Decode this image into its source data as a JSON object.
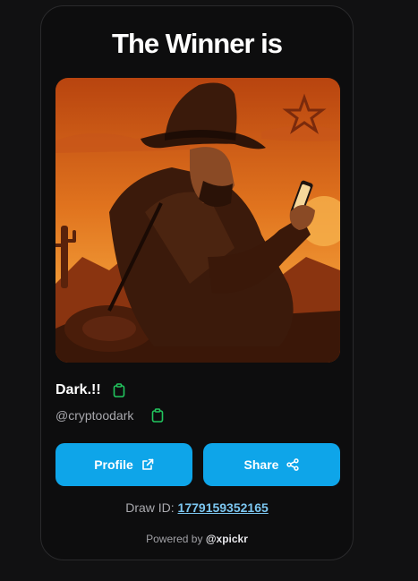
{
  "card": {
    "title": "The Winner is"
  },
  "winner": {
    "avatar_alt": "Cowboy with phone illustration",
    "name": "Dark.!!",
    "handle": "@cryptoodark"
  },
  "actions": {
    "profile_label": "Profile",
    "share_label": "Share"
  },
  "draw": {
    "label": "Draw ID:",
    "id": "1779159352165"
  },
  "footer": {
    "powered_label": "Powered by",
    "brand": "@xpickr"
  },
  "icons": {
    "copy": "clipboard-icon",
    "external": "external-link-icon",
    "share": "share-icon"
  },
  "colors": {
    "accent": "#0ea5e9",
    "copy_icon": "#22c55e",
    "link": "#7cc6f0",
    "background": "#111112",
    "card": "#0d0d0e"
  }
}
